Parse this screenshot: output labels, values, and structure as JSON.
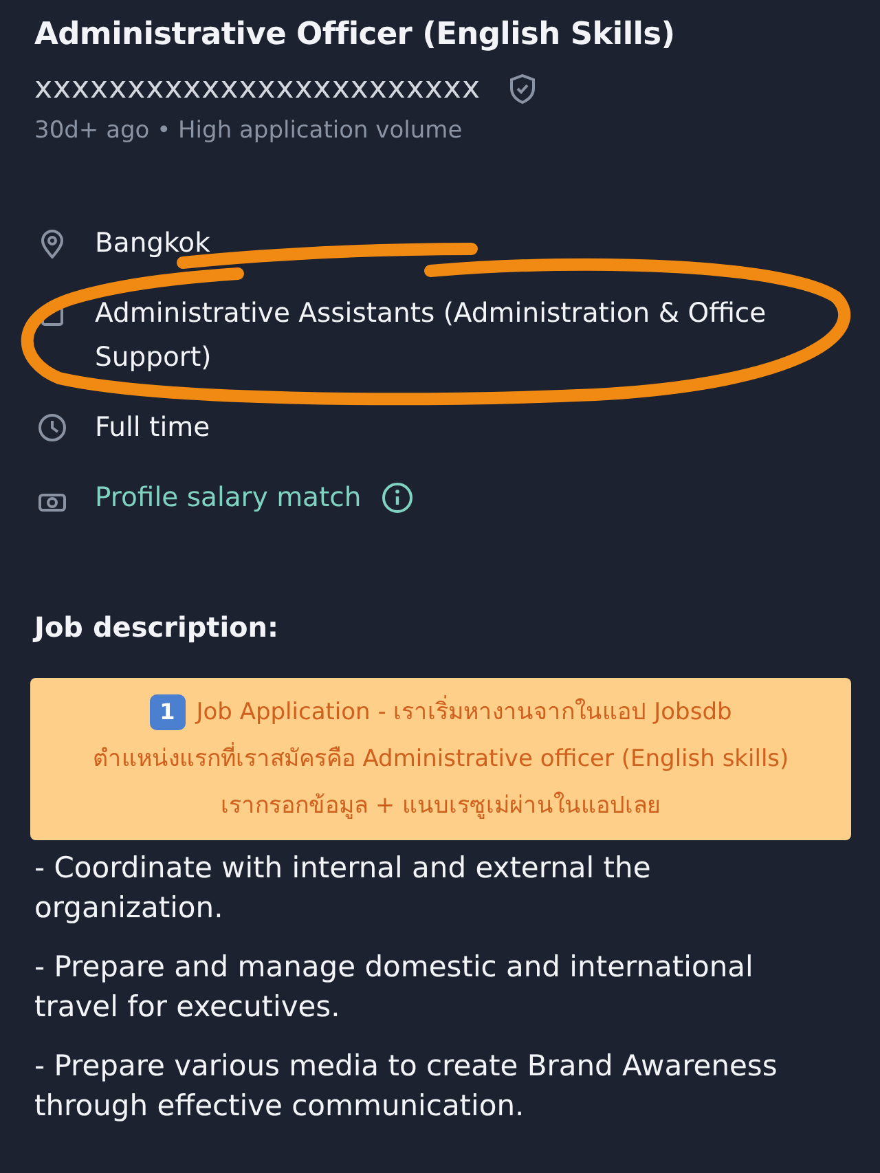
{
  "job": {
    "title": "Administrative Officer (English Skills)",
    "company": "xxxxxxxxxxxxxxxxxxxxxxxx",
    "verified": true,
    "meta": "30d+ ago • High application volume"
  },
  "details": [
    {
      "kind": "location",
      "text": "Bangkok"
    },
    {
      "kind": "category",
      "text": "Administrative Assistants (Administration & Office Support)"
    },
    {
      "kind": "worktype",
      "text": "Full time"
    },
    {
      "kind": "salary",
      "text": "Profile salary match"
    }
  ],
  "description": {
    "heading": "Job description:",
    "note": {
      "badge": "1",
      "lines": [
        "Job Application - เราเริ่มหางานจากในแอป Jobsdb",
        "ตำแหน่งแรกที่เราสมัครคือ Administrative officer (English skills)",
        "เรากรอกข้อมูล + แนบเรซูเม่ผ่านในแอปเลย"
      ]
    },
    "paragraphs": [
      "- Coordinate with internal and external the organization.",
      "- Prepare and manage domestic and international travel for executives.",
      "- Prepare various media to create Brand Awareness through effective communication."
    ]
  }
}
